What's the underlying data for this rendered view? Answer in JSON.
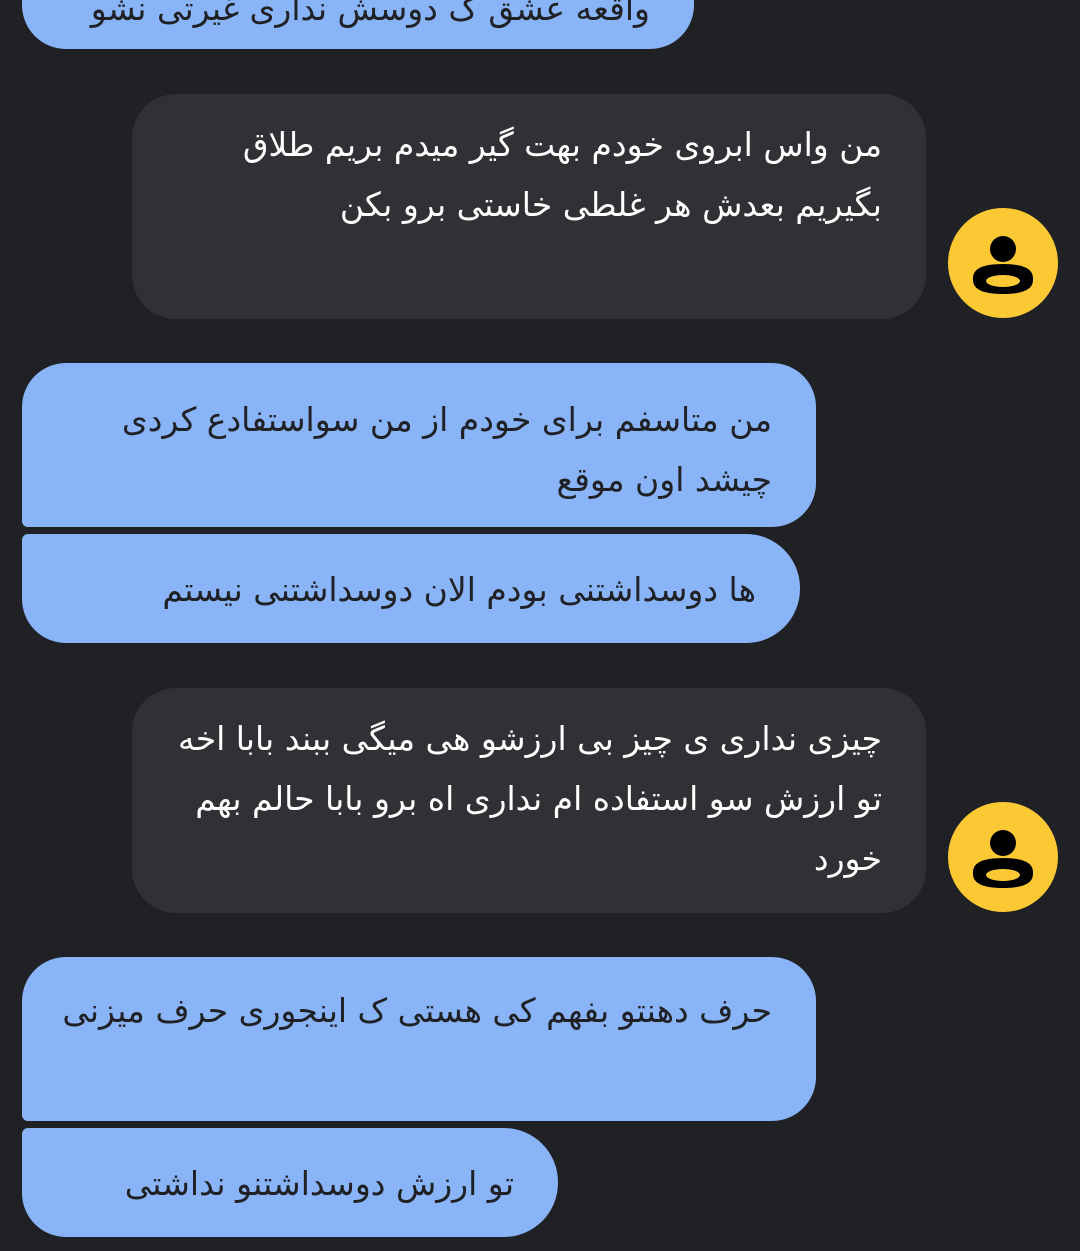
{
  "colors": {
    "background": "#202124",
    "outgoing_bubble": "#8ab4f8",
    "incoming_bubble": "#303134",
    "avatar": "#fcc934"
  },
  "messages": [
    {
      "direction": "outgoing",
      "text": "واقعه عشق ک دوسش نداری غیرتی نشو"
    },
    {
      "direction": "incoming",
      "avatar_icon": "person-icon",
      "text": "من واس ابروی خودم بهت گیر میدم بریم طلاق بگیریم بعدش هر غلطی خاستی برو بکن"
    },
    {
      "direction": "outgoing",
      "text": "من متاسفم برای خودم از من سواستفادع کردی چیشد اون موقع"
    },
    {
      "direction": "outgoing",
      "text": "ها دوسداشتنی بودم الان دوسداشتنی نیستم"
    },
    {
      "direction": "incoming",
      "avatar_icon": "person-icon",
      "text": "چیزی نداری ی چیز بی ارزشو هی میگی ببند بابا اخه تو ارزش سو استفاده ام نداری اه برو بابا حالم بهم خورد"
    },
    {
      "direction": "outgoing",
      "text": "حرف دهنتو بفهم کی هستی ک اینجوری حرف میزنی"
    },
    {
      "direction": "outgoing",
      "text": "تو ارزش دوسداشتنو نداشتی"
    }
  ]
}
